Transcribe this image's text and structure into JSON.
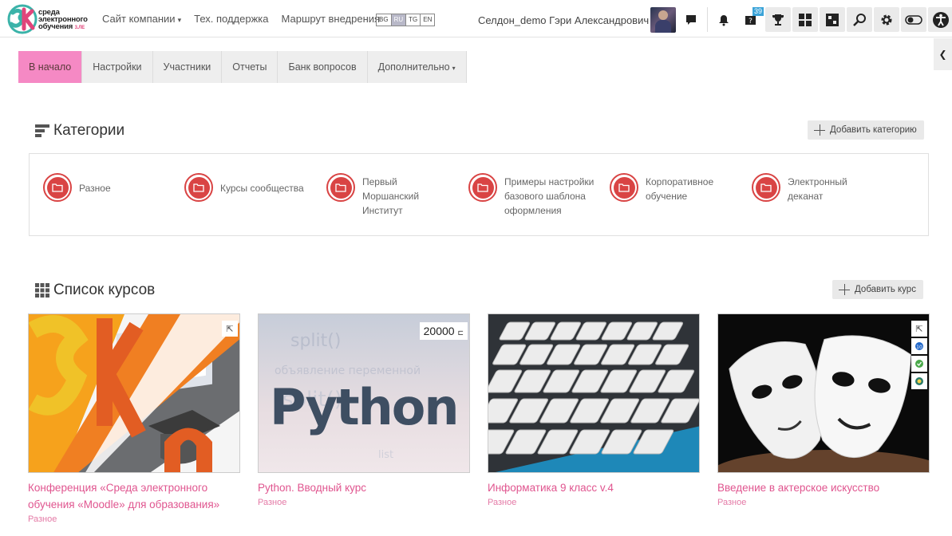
{
  "brand": {
    "logo_text_1": "среда",
    "logo_text_2": "электронного",
    "logo_text_3": "обучения",
    "logo_sub": "3.ЛЕ"
  },
  "nav": {
    "items": [
      {
        "label": "Сайт компании",
        "has_caret": true
      },
      {
        "label": "Тех. поддержка",
        "has_caret": false
      },
      {
        "label": "Маршрут внедрения",
        "has_caret": false
      }
    ],
    "languages": [
      "BG",
      "RU",
      "TG",
      "EN"
    ],
    "active_language": "RU",
    "user_name": "Селдон_demo Гэри Александрович",
    "help_badge": "39",
    "icons": [
      "chat-icon",
      "bell-icon",
      "help-icon",
      "trophy-icon",
      "dashboard-icon",
      "blocks-icon",
      "search-icon",
      "gear-icon",
      "toggle-icon",
      "accessibility-icon"
    ]
  },
  "tabs": [
    {
      "label": "В начало",
      "active": true
    },
    {
      "label": "Настройки",
      "active": false
    },
    {
      "label": "Участники",
      "active": false
    },
    {
      "label": "Отчеты",
      "active": false
    },
    {
      "label": "Банк вопросов",
      "active": false
    },
    {
      "label": "Дополнительно",
      "active": false,
      "has_caret": true
    }
  ],
  "categories_section": {
    "title": "Категории",
    "add_button": "Добавить категорию",
    "items": [
      {
        "label": "Разное"
      },
      {
        "label": "Курсы сообщества"
      },
      {
        "label": "Первый Моршанский Институт"
      },
      {
        "label": "Примеры настройки базового шаблона оформления"
      },
      {
        "label": "Корпоративное обучение"
      },
      {
        "label": "Электронный деканат"
      }
    ]
  },
  "courses_section": {
    "title": "Список курсов",
    "add_button": "Добавить курс",
    "items": [
      {
        "title": "Конференция «Среда электронного обучения «Moodle» для образования»",
        "category": "Разное"
      },
      {
        "title": "Python. Вводный курс",
        "category": "Разное",
        "price": "20000",
        "thumb_text": "Python"
      },
      {
        "title": "Информатика 9 класс v.4",
        "category": "Разное"
      },
      {
        "title": "Введение в актерское искусство",
        "category": "Разное"
      }
    ]
  },
  "colors": {
    "accent": "#f589c4",
    "link": "#e0558f",
    "folder": "#d94444"
  }
}
